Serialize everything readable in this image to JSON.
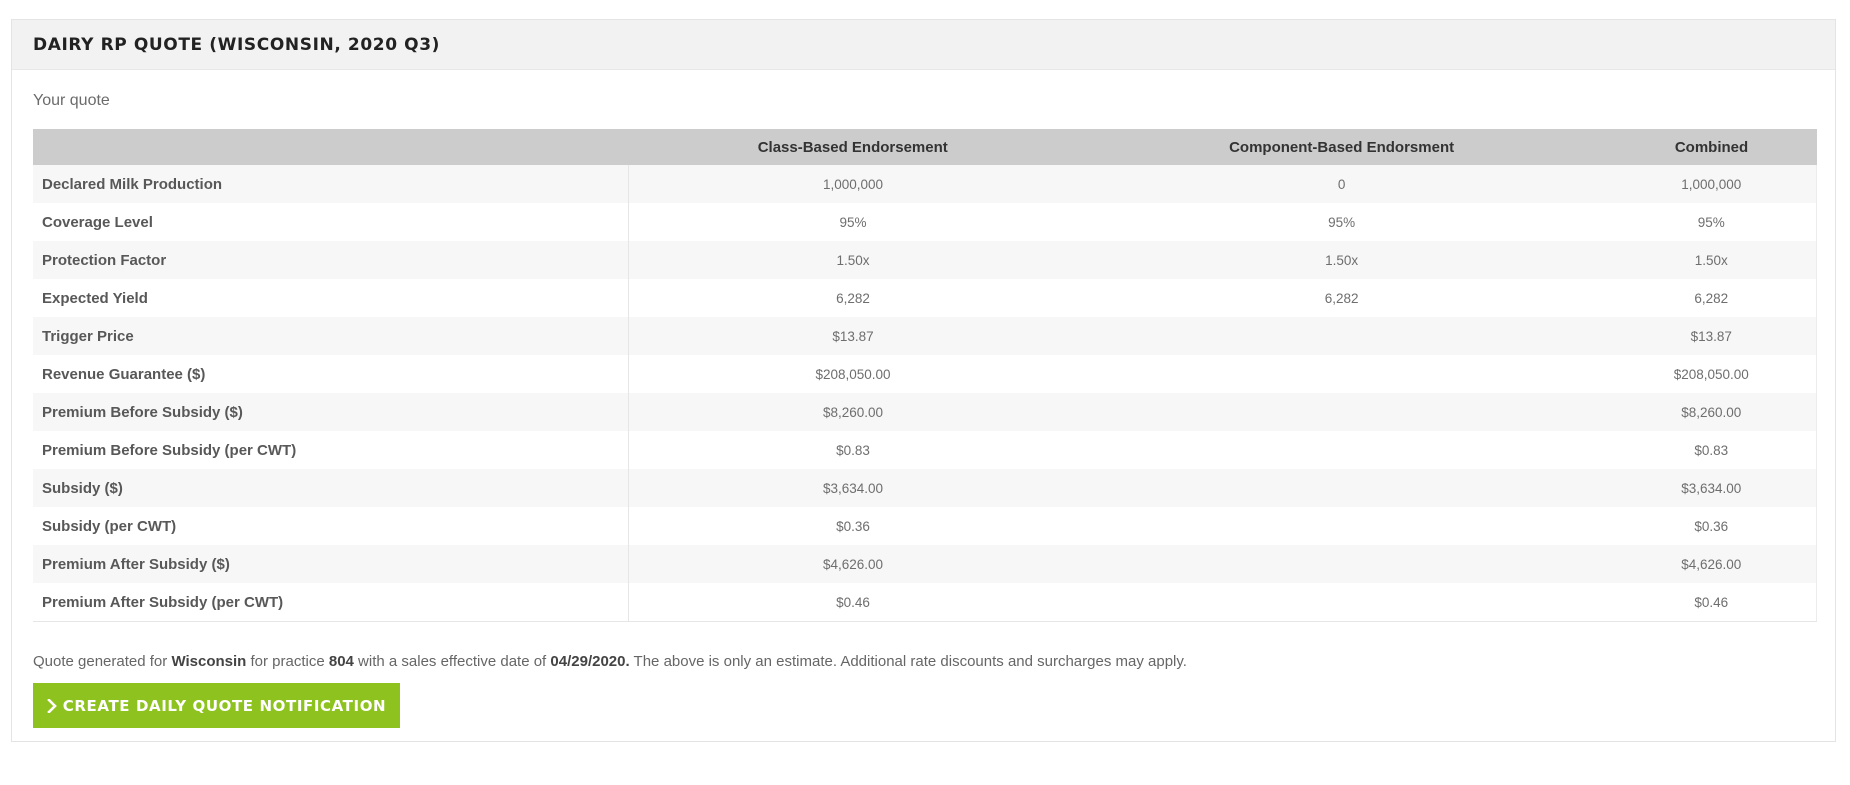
{
  "panel": {
    "title": "DAIRY RP QUOTE (WISCONSIN, 2020 Q3)",
    "subtitle": "Your quote"
  },
  "table": {
    "headers": [
      "",
      "Class-Based Endorsement",
      "Component-Based Endorsment",
      "Combined"
    ],
    "rows": [
      {
        "label": "Declared Milk Production",
        "class": "1,000,000",
        "component": "0",
        "combined": "1,000,000"
      },
      {
        "label": "Coverage Level",
        "class": "95%",
        "component": "95%",
        "combined": "95%"
      },
      {
        "label": "Protection Factor",
        "class": "1.50x",
        "component": "1.50x",
        "combined": "1.50x"
      },
      {
        "label": "Expected Yield",
        "class": "6,282",
        "component": "6,282",
        "combined": "6,282"
      },
      {
        "label": "Trigger Price",
        "class": "$13.87",
        "component": "",
        "combined": "$13.87"
      },
      {
        "label": "Revenue Guarantee ($)",
        "class": "$208,050.00",
        "component": "",
        "combined": "$208,050.00"
      },
      {
        "label": "Premium Before Subsidy ($)",
        "class": "$8,260.00",
        "component": "",
        "combined": "$8,260.00"
      },
      {
        "label": "Premium Before Subsidy (per CWT)",
        "class": "$0.83",
        "component": "",
        "combined": "$0.83"
      },
      {
        "label": "Subsidy ($)",
        "class": "$3,634.00",
        "component": "",
        "combined": "$3,634.00"
      },
      {
        "label": "Subsidy (per CWT)",
        "class": "$0.36",
        "component": "",
        "combined": "$0.36"
      },
      {
        "label": "Premium After Subsidy ($)",
        "class": "$4,626.00",
        "component": "",
        "combined": "$4,626.00"
      },
      {
        "label": "Premium After Subsidy (per CWT)",
        "class": "$0.46",
        "component": "",
        "combined": "$0.46"
      }
    ]
  },
  "footer": {
    "prefix": "Quote generated for ",
    "state": "Wisconsin",
    "mid1": " for practice ",
    "practice": "804",
    "mid2": " with a sales effective date of ",
    "date": "04/29/2020.",
    "suffix": " The above is only an estimate. Additional rate discounts and surcharges may apply."
  },
  "cta": {
    "label": "CREATE DAILY QUOTE NOTIFICATION",
    "icon": "chevron-right-icon",
    "color": "#8dc21f"
  }
}
